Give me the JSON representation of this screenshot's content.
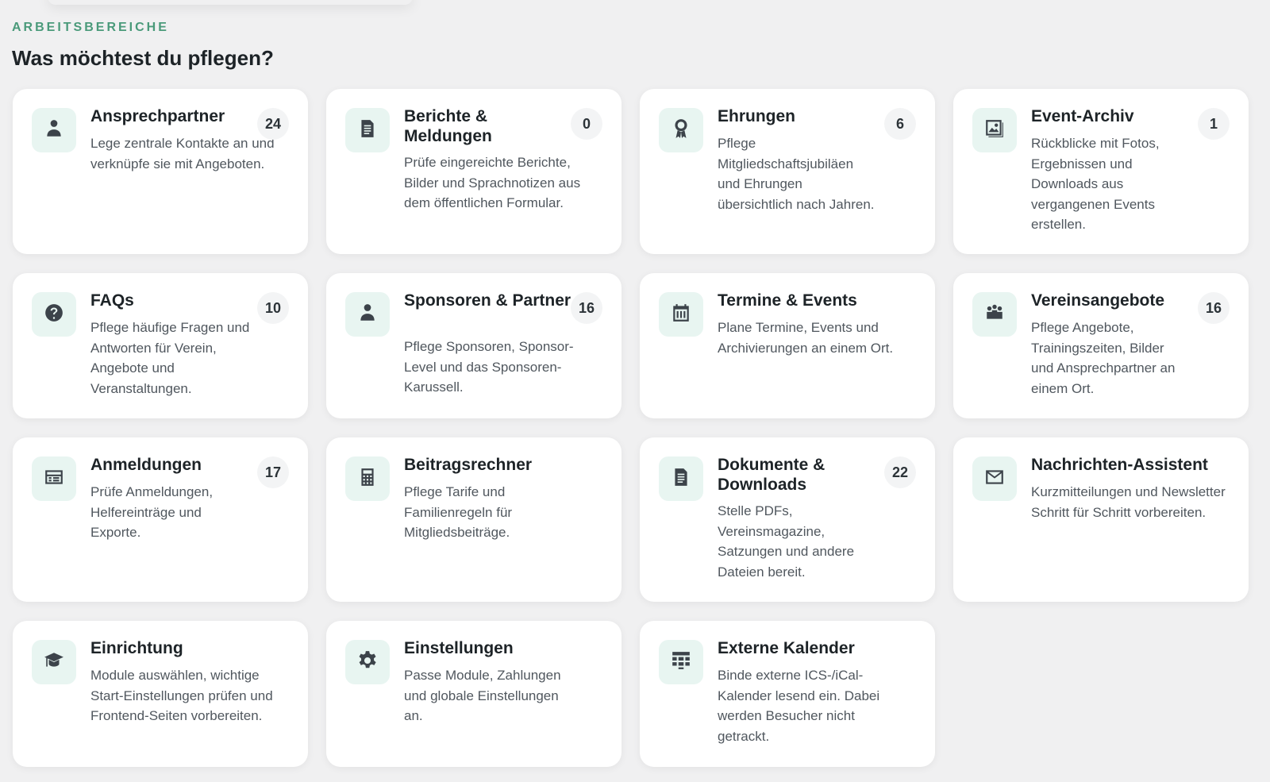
{
  "section": {
    "eyebrow": "ARBEITSBEREICHE",
    "heading": "Was möchtest du pflegen?"
  },
  "cards": [
    {
      "title": "Ansprechpartner",
      "description": "Lege zentrale Kontakte an und verknüpfe sie mit Angeboten.",
      "count": "24",
      "icon": "person-icon"
    },
    {
      "title": "Berichte & Meldungen",
      "description": "Prüfe eingereichte Berichte, Bilder und Sprachnotizen aus dem öffentlichen Formular.",
      "count": "0",
      "icon": "document-icon"
    },
    {
      "title": "Ehrungen",
      "description": "Pflege Mitgliedschaftsjubiläen und Ehrungen übersichtlich nach Jahren.",
      "count": "6",
      "icon": "award-icon"
    },
    {
      "title": "Event-Archiv",
      "description": "Rückblicke mit Fotos, Ergebnissen und Downloads aus vergangenen Events erstellen.",
      "count": "1",
      "icon": "gallery-icon"
    },
    {
      "title": "FAQs",
      "description": "Pflege häufige Fragen und Antworten für Verein, Angebote und Veranstaltungen.",
      "count": "10",
      "icon": "help-icon"
    },
    {
      "title": "Sponsoren & Partner",
      "description": "Pflege Sponsoren, Sponsor-Level und das Sponsoren-Karussell.",
      "count": "16",
      "icon": "person-icon"
    },
    {
      "title": "Termine & Events",
      "description": "Plane Termine, Events und Archivierungen an einem Ort.",
      "count": "",
      "icon": "calendar-icon"
    },
    {
      "title": "Vereinsangebote",
      "description": "Pflege Angebote, Trainingszeiten, Bilder und Ansprechpartner an einem Ort.",
      "count": "16",
      "icon": "groups-icon"
    },
    {
      "title": "Anmeldungen",
      "description": "Prüfe Anmeldungen, Helfereinträge und Exporte.",
      "count": "17",
      "icon": "forms-icon"
    },
    {
      "title": "Beitragsrechner",
      "description": "Pflege Tarife und Familienregeln für Mitgliedsbeiträge.",
      "count": "",
      "icon": "calculator-icon"
    },
    {
      "title": "Dokumente & Downloads",
      "description": "Stelle PDFs, Vereinsmagazine, Satzungen und andere Dateien bereit.",
      "count": "22",
      "icon": "document-icon"
    },
    {
      "title": "Nachrichten-Assistent",
      "description": "Kurzmitteilungen und Newsletter Schritt für Schritt vorbereiten.",
      "count": "",
      "icon": "email-icon"
    },
    {
      "title": "Einrichtung",
      "description": "Module auswählen, wichtige Start-Einstellungen prüfen und Frontend-Seiten vorbereiten.",
      "count": "",
      "icon": "graduation-cap-icon"
    },
    {
      "title": "Einstellungen",
      "description": "Passe Module, Zahlungen und globale Einstellungen an.",
      "count": "",
      "icon": "gear-icon"
    },
    {
      "title": "Externe Kalender",
      "description": "Binde externe ICS-/iCal-Kalender lesend ein. Dabei werden Besucher nicht getrackt.",
      "count": "",
      "icon": "grid-calendar-icon"
    }
  ]
}
